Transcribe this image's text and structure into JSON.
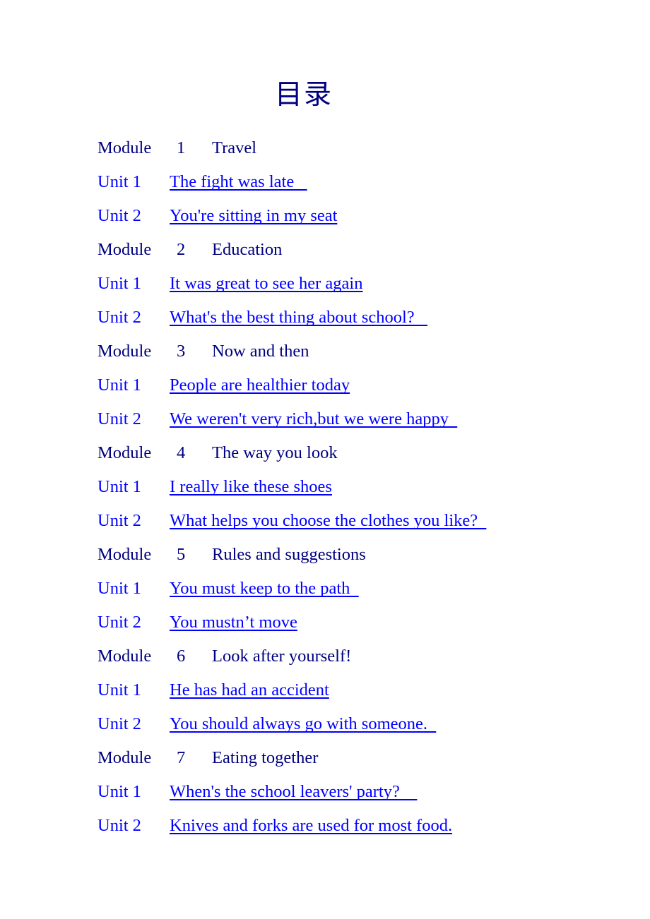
{
  "document": {
    "title": "目录",
    "title_color": "#000080",
    "link_color": "#0000FF",
    "background": "#FFFFFF"
  },
  "contents": [
    {
      "module_word": "Module",
      "module_number": "1",
      "module_title": "Travel",
      "units": [
        {
          "label": "Unit 1",
          "title": "The fight was late   "
        },
        {
          "label": "Unit 2",
          "title": "You're sitting in my seat"
        }
      ]
    },
    {
      "module_word": "Module",
      "module_number": "2",
      "module_title": "Education",
      "units": [
        {
          "label": "Unit 1",
          "title": "It was great to see her again"
        },
        {
          "label": "Unit 2",
          "title": "What's the best thing about school?   "
        }
      ]
    },
    {
      "module_word": "Module",
      "module_number": "3",
      "module_title": "Now and then",
      "units": [
        {
          "label": "Unit 1",
          "title": "People are healthier today"
        },
        {
          "label": "Unit 2",
          "title": "We weren't very rich,but we were happy  "
        }
      ]
    },
    {
      "module_word": "Module",
      "module_number": "4",
      "module_title": "The way you look",
      "units": [
        {
          "label": "Unit 1",
          "title": "I really like these shoes"
        },
        {
          "label": "Unit 2",
          "title": "What helps you choose the clothes you like?  "
        }
      ]
    },
    {
      "module_word": "Module",
      "module_number": "5",
      "module_title": "Rules and suggestions",
      "units": [
        {
          "label": "Unit 1",
          "title": "You must keep to the path  "
        },
        {
          "label": "Unit 2",
          "title": "You mustn’t move"
        }
      ]
    },
    {
      "module_word": "Module",
      "module_number": "6",
      "module_title": "Look after yourself!",
      "units": [
        {
          "label": "Unit 1",
          "title": "He has had an accident"
        },
        {
          "label": "Unit 2",
          "title": "You should always go with someone.  "
        }
      ]
    },
    {
      "module_word": "Module",
      "module_number": "7",
      "module_title": "Eating together",
      "units": [
        {
          "label": "Unit 1",
          "title": "When's the school leavers' party?    "
        },
        {
          "label": "Unit 2",
          "title": "Knives and forks are used for most food."
        }
      ]
    }
  ]
}
